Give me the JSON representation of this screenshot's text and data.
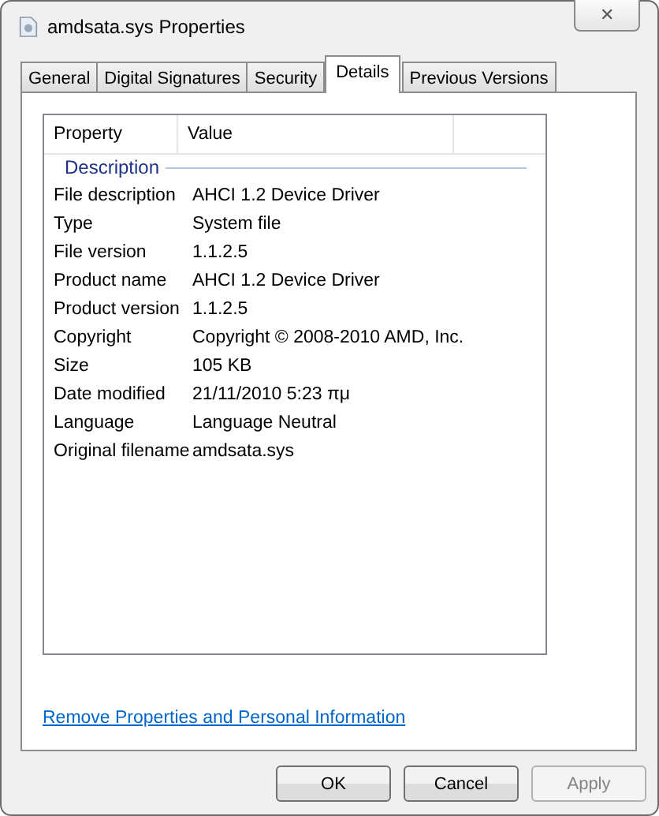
{
  "window": {
    "title": "amdsata.sys Properties",
    "close": "✕"
  },
  "tabs": [
    {
      "label": "General",
      "selected": false
    },
    {
      "label": "Digital Signatures",
      "selected": false
    },
    {
      "label": "Security",
      "selected": false
    },
    {
      "label": "Details",
      "selected": true
    },
    {
      "label": "Previous Versions",
      "selected": false
    }
  ],
  "table": {
    "columns": [
      "Property",
      "Value"
    ],
    "group": "Description",
    "rows": [
      {
        "property": "File description",
        "value": "AHCI 1.2 Device Driver"
      },
      {
        "property": "Type",
        "value": "System file"
      },
      {
        "property": "File version",
        "value": "1.1.2.5"
      },
      {
        "property": "Product name",
        "value": "AHCI 1.2 Device Driver"
      },
      {
        "property": "Product version",
        "value": "1.1.2.5"
      },
      {
        "property": "Copyright",
        "value": "Copyright © 2008-2010 AMD, Inc."
      },
      {
        "property": "Size",
        "value": "105 KB"
      },
      {
        "property": "Date modified",
        "value": "21/11/2010 5:23 πμ"
      },
      {
        "property": "Language",
        "value": "Language Neutral"
      },
      {
        "property": "Original filename",
        "value": "amdsata.sys"
      }
    ]
  },
  "link": "Remove Properties and Personal Information",
  "buttons": [
    {
      "label": "OK",
      "disabled": false
    },
    {
      "label": "Cancel",
      "disabled": false
    },
    {
      "label": "Apply",
      "disabled": true
    }
  ]
}
